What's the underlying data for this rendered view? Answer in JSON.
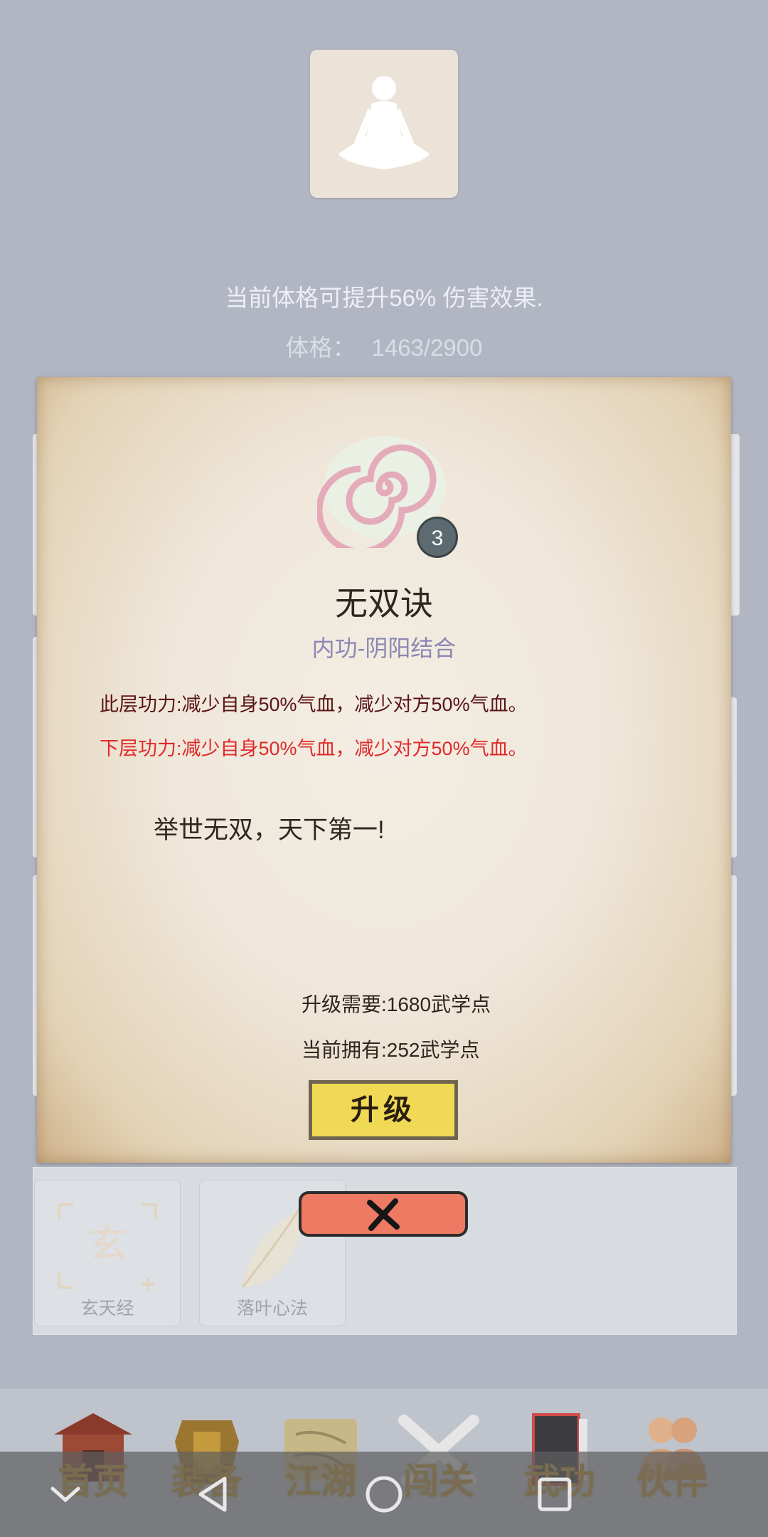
{
  "character": {
    "portrait_icon": "meditating-figure-icon",
    "boost_text": "当前体格可提升56% 伤害效果.",
    "constitution_label": "体格：",
    "constitution_value": "1463/2900"
  },
  "skill_dialog": {
    "icon": "spiral-icon",
    "level": "3",
    "name": "无双诀",
    "type": "内功-阴阳结合",
    "current_effect": "此层功力:减少自身50%气血，减少对方50%气血。",
    "next_effect": "下层功力:减少自身50%气血，减少对方50%气血。",
    "motto": "举世无双，天下第一!",
    "upgrade_cost": "升级需要:1680武学点",
    "current_points": "当前拥有:252武学点",
    "upgrade_label": "升级",
    "close_icon": "close-icon"
  },
  "skill_list": [
    {
      "name": "玄天经",
      "icon": "xuantian-scroll-icon"
    },
    {
      "name": "落叶心法",
      "icon": "leaf-icon"
    }
  ],
  "tabs": [
    {
      "label": "首页",
      "icon": "temple-icon"
    },
    {
      "label": "装备",
      "icon": "armor-icon"
    },
    {
      "label": "江湖",
      "icon": "map-scroll-icon"
    },
    {
      "label": "闯关",
      "icon": "crossed-swords-icon"
    },
    {
      "label": "武功",
      "icon": "book-icon"
    },
    {
      "label": "伙伴",
      "icon": "partners-icon"
    }
  ],
  "system_nav": {
    "buttons": [
      "chevron-down-icon",
      "back-icon",
      "home-icon",
      "recents-icon"
    ]
  },
  "colors": {
    "background": "#b2b6c2",
    "effect_next": "#e02a2a",
    "effect_current": "#5a1414",
    "skill_type": "#8b87b4",
    "upgrade_button": "#f0da55",
    "close_button": "#ee7a64",
    "tab_gold": "#b98e2a"
  }
}
